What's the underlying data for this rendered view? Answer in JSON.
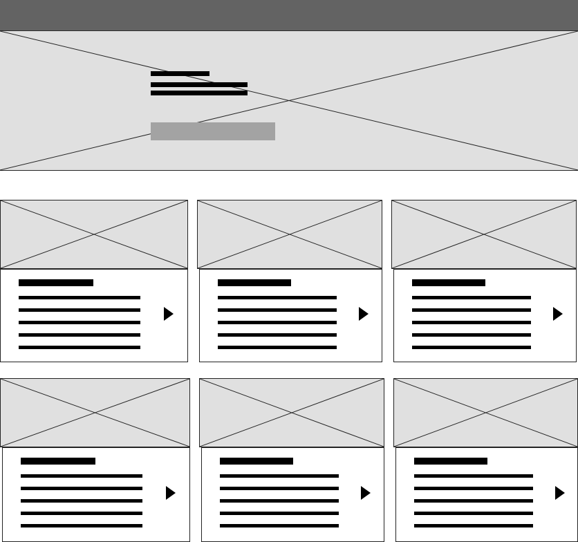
{
  "wireframe": {
    "header": {},
    "hero": {
      "text_lines": 3,
      "has_button": true
    },
    "cards": [
      {
        "row": 1,
        "col": 1,
        "text_lines": 5,
        "arrow_icon": "play-right-icon"
      },
      {
        "row": 1,
        "col": 2,
        "text_lines": 5,
        "arrow_icon": "play-right-icon"
      },
      {
        "row": 1,
        "col": 3,
        "text_lines": 5,
        "arrow_icon": "play-right-icon"
      },
      {
        "row": 2,
        "col": 1,
        "text_lines": 5,
        "arrow_icon": "play-right-icon"
      },
      {
        "row": 2,
        "col": 2,
        "text_lines": 5,
        "arrow_icon": "play-right-icon"
      },
      {
        "row": 2,
        "col": 3,
        "text_lines": 5,
        "arrow_icon": "play-right-icon"
      }
    ],
    "colors": {
      "header": "#636363",
      "placeholder": "#e0e0e0",
      "button": "#a3a3a3",
      "text_bar": "#000000"
    }
  }
}
